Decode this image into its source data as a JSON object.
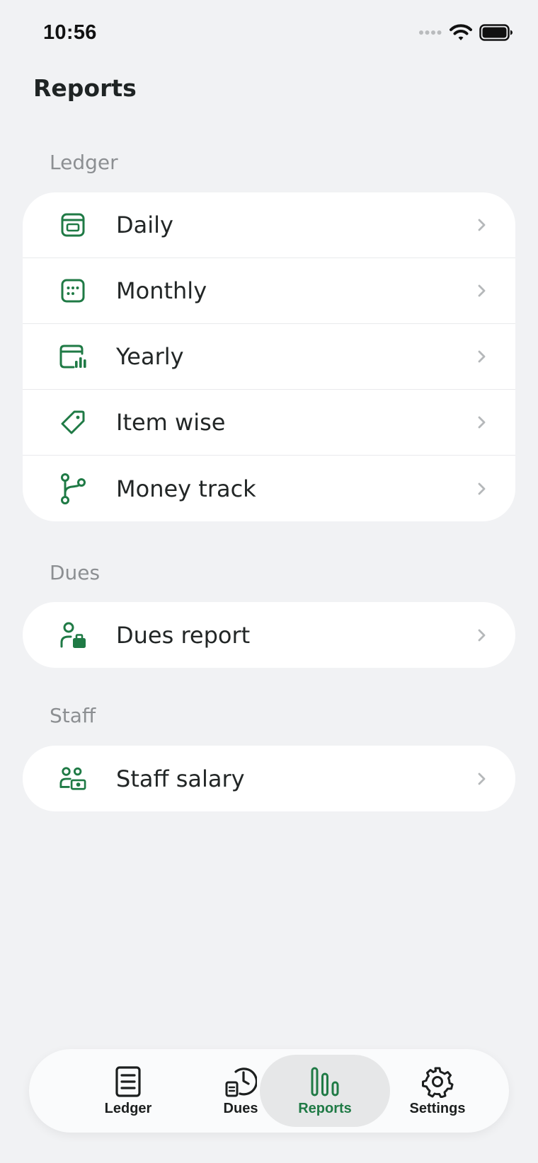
{
  "status_bar": {
    "time": "10:56",
    "icons": [
      "signal-dots-icon",
      "wifi-icon",
      "battery-icon"
    ]
  },
  "page": {
    "title": "Reports"
  },
  "colors": {
    "accent": "#1f7a45",
    "background": "#f1f2f4",
    "card": "#ffffff",
    "section_label": "#8c8f92",
    "chevron": "#b5b8ba"
  },
  "sections": {
    "ledger": {
      "label": "Ledger",
      "items": [
        {
          "label": "Daily",
          "icon": "daily-calendar-icon"
        },
        {
          "label": "Monthly",
          "icon": "monthly-calendar-icon"
        },
        {
          "label": "Yearly",
          "icon": "yearly-chart-icon"
        },
        {
          "label": "Item wise",
          "icon": "tag-icon"
        },
        {
          "label": "Money track",
          "icon": "branch-icon"
        }
      ]
    },
    "dues": {
      "label": "Dues",
      "items": [
        {
          "label": "Dues report",
          "icon": "user-bag-icon"
        }
      ]
    },
    "staff": {
      "label": "Staff",
      "items": [
        {
          "label": "Staff salary",
          "icon": "staff-cash-icon"
        }
      ]
    }
  },
  "tabbar": {
    "active": "Reports",
    "tabs": [
      {
        "label": "Ledger",
        "icon": "ledger-doc-icon"
      },
      {
        "label": "Dues",
        "icon": "dues-clock-icon"
      },
      {
        "label": "Reports",
        "icon": "reports-bars-icon"
      },
      {
        "label": "Settings",
        "icon": "settings-gear-icon"
      }
    ]
  }
}
